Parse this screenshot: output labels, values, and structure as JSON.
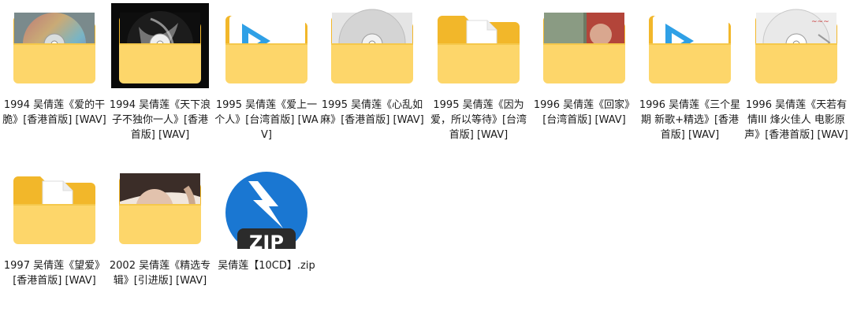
{
  "items": [
    {
      "name": "1994 吴倩莲《爱的干脆》[香港首版] [WAV]",
      "type": "folder",
      "preview": "cd-color",
      "icon": "folder-with-cd-icon"
    },
    {
      "name": "1994 吴倩莲《天下浪子不独你一人》[香港首版] [WAV]",
      "type": "folder",
      "preview": "cd-dark",
      "icon": "folder-with-cd-icon"
    },
    {
      "name": "1995 吴倩莲《爱上一个人》[台湾首版] [WAV]",
      "type": "folder",
      "preview": "play",
      "icon": "folder-with-media-icon"
    },
    {
      "name": "1995 吴倩莲《心乱如麻》[香港首版] [WAV]",
      "type": "folder",
      "preview": "cd-silver",
      "icon": "folder-with-cd-icon"
    },
    {
      "name": "1995 吴倩莲《因为爱，所以等待》[台湾首版] [WAV]",
      "type": "folder",
      "preview": "doc",
      "icon": "folder-with-document-icon"
    },
    {
      "name": "1996 吴倩莲《回家》[台湾首版] [WAV]",
      "type": "folder",
      "preview": "photo-red",
      "icon": "folder-with-photo-icon"
    },
    {
      "name": "1996 吴倩莲《三个星期 新歌+精选》[香港首版] [WAV]",
      "type": "folder",
      "preview": "play",
      "icon": "folder-with-media-icon"
    },
    {
      "name": "1996 吴倩莲《天若有情III 烽火佳人 电影原声》[香港首版] [WAV]",
      "type": "folder",
      "preview": "cd-white",
      "icon": "folder-with-cd-icon"
    },
    {
      "name": "1997 吴倩莲《望爱》[香港首版] [WAV]",
      "type": "folder",
      "preview": "doc",
      "icon": "folder-with-document-icon"
    },
    {
      "name": "2002 吴倩莲《精选专辑》[引进版] [WAV]",
      "type": "folder",
      "preview": "photo-face",
      "icon": "folder-with-photo-icon"
    },
    {
      "name": "吴倩莲【10CD】.zip",
      "type": "zip",
      "preview": "zip",
      "icon": "zip-archive-icon",
      "badge": "ZIP"
    }
  ],
  "colors": {
    "folder_back": "#f2b72a",
    "folder_front": "#fdd66a",
    "zip_blue": "#1a77d2",
    "zip_badge": "#2b2b2b",
    "play_blue": "#2fa0e6"
  }
}
